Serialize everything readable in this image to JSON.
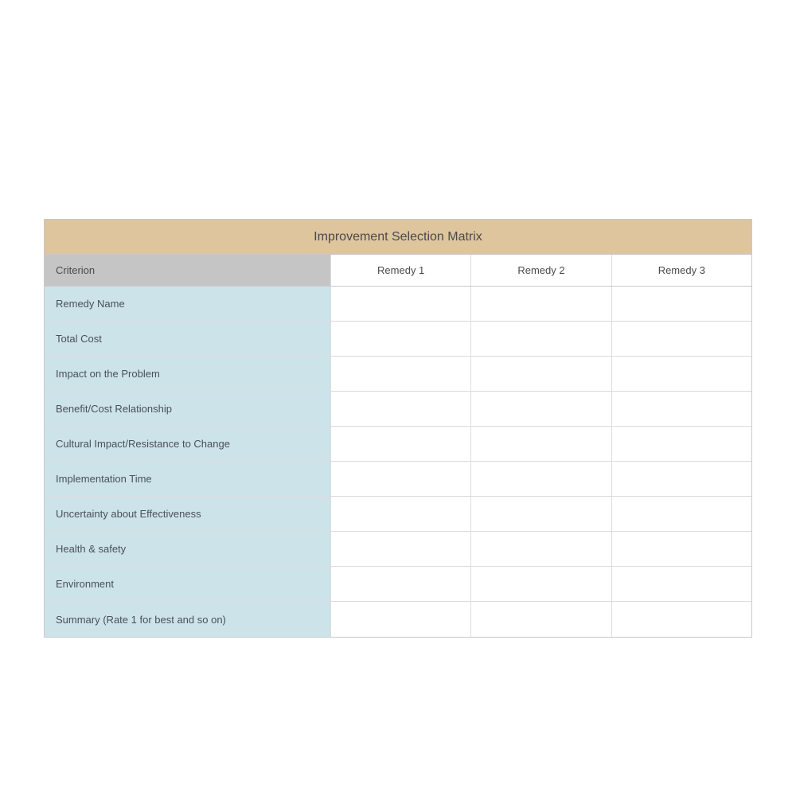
{
  "title": "Improvement Selection Matrix",
  "headers": {
    "criterion": "Criterion",
    "remedy1": "Remedy 1",
    "remedy2": "Remedy 2",
    "remedy3": "Remedy 3"
  },
  "rows": [
    {
      "label": "Remedy Name",
      "r1": "",
      "r2": "",
      "r3": ""
    },
    {
      "label": "Total Cost",
      "r1": "",
      "r2": "",
      "r3": ""
    },
    {
      "label": "Impact on the Problem",
      "r1": "",
      "r2": "",
      "r3": ""
    },
    {
      "label": "Benefit/Cost Relationship",
      "r1": "",
      "r2": "",
      "r3": ""
    },
    {
      "label": "Cultural Impact/Resistance to Change",
      "r1": "",
      "r2": "",
      "r3": ""
    },
    {
      "label": "Implementation Time",
      "r1": "",
      "r2": "",
      "r3": ""
    },
    {
      "label": "Uncertainty about Effectiveness",
      "r1": "",
      "r2": "",
      "r3": ""
    },
    {
      "label": "Health & safety",
      "r1": "",
      "r2": "",
      "r3": ""
    },
    {
      "label": "Environment",
      "r1": "",
      "r2": "",
      "r3": ""
    },
    {
      "label": "Summary (Rate 1 for best and so on)",
      "r1": "",
      "r2": "",
      "r3": ""
    }
  ]
}
